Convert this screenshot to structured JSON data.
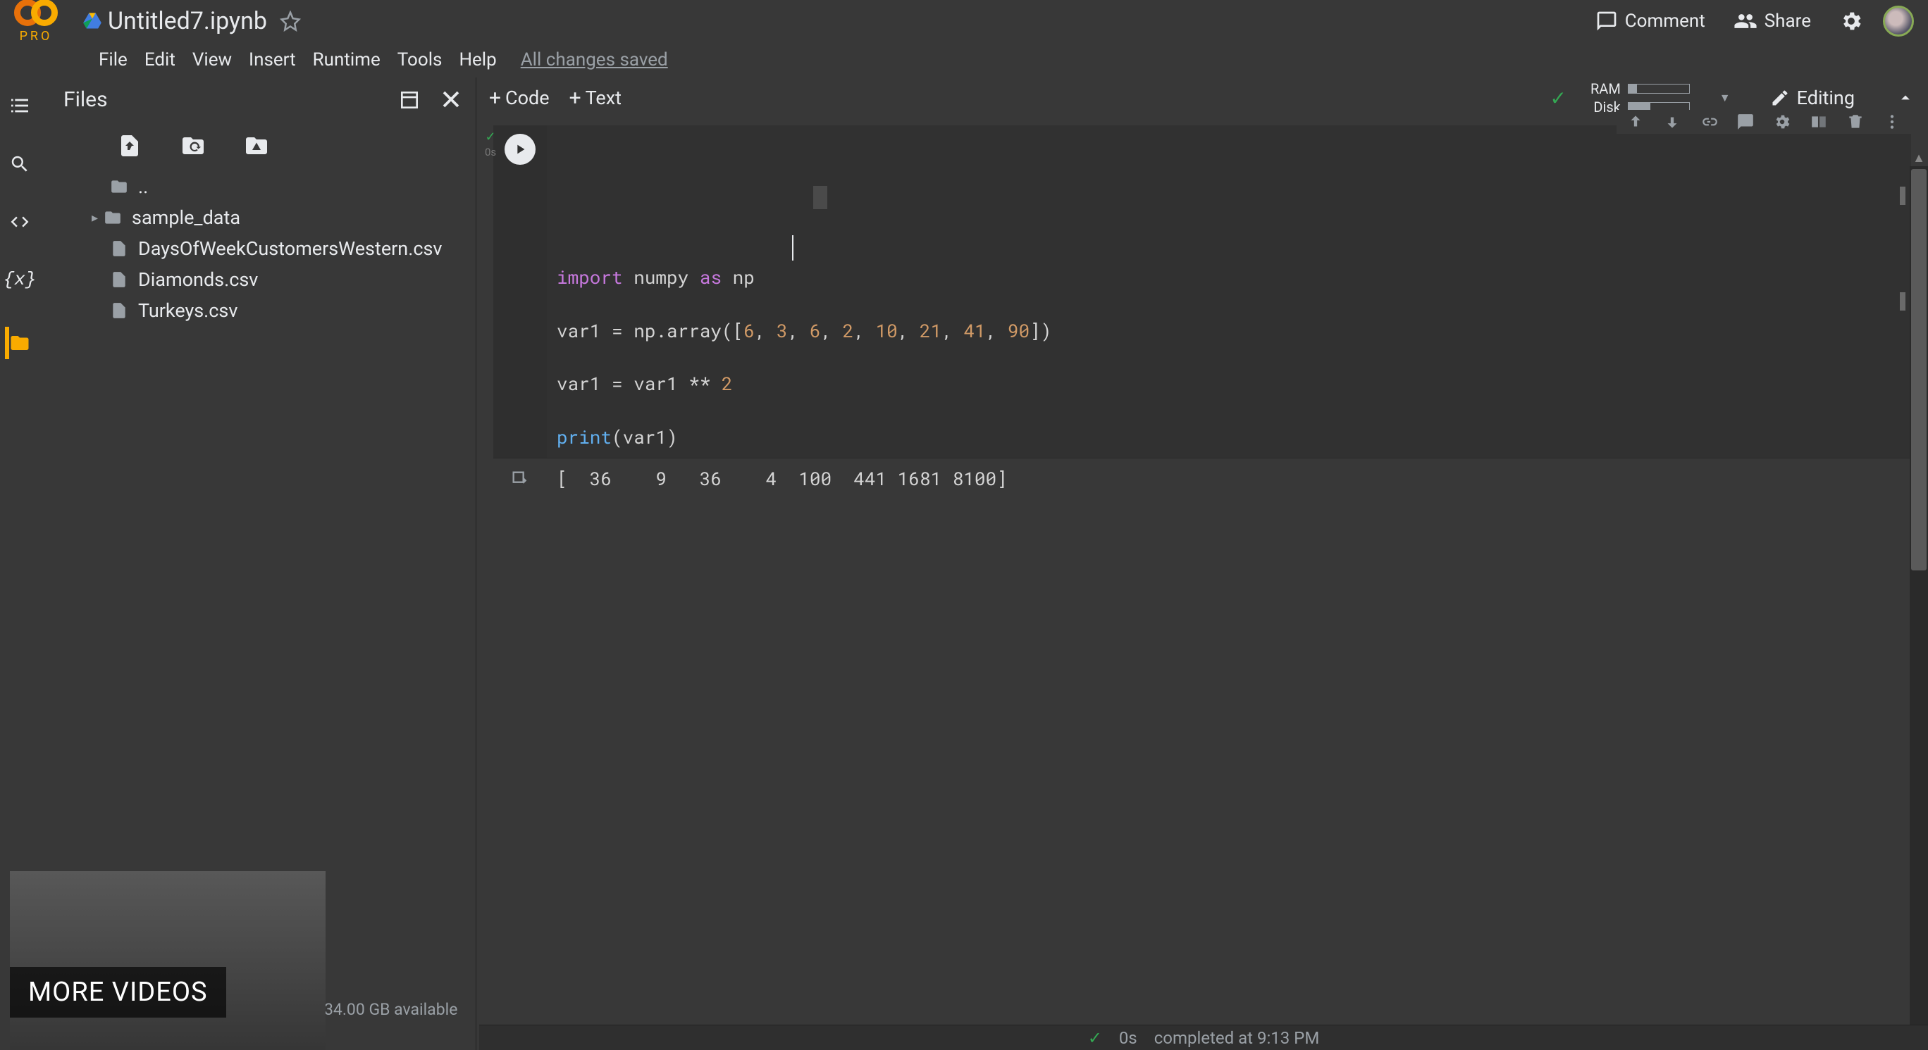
{
  "header": {
    "pro_label": "PRO",
    "notebook_title": "Untitled7.ipynb",
    "comment_label": "Comment",
    "share_label": "Share"
  },
  "menu": {
    "items": [
      "File",
      "Edit",
      "View",
      "Insert",
      "Runtime",
      "Tools",
      "Help"
    ],
    "save_status": "All changes saved"
  },
  "sidebar": {
    "title": "Files",
    "tree": {
      "parent": "..",
      "folder": "sample_data",
      "files": [
        "DaysOfWeekCustomersWestern.csv",
        "Diamonds.csv",
        "Turkeys.csv"
      ]
    },
    "disk_available": "34.00 GB available"
  },
  "toolbar": {
    "add_code": "Code",
    "add_text": "Text",
    "ram_label": "RAM",
    "disk_label": "Disk",
    "ram_fill_pct": 14,
    "disk_fill_pct": 36,
    "editing_label": "Editing"
  },
  "cell": {
    "exec_time": "0s",
    "code_lines": [
      {
        "tokens": [
          [
            "import",
            "keyword"
          ],
          [
            " numpy ",
            "default"
          ],
          [
            "as",
            "keyword"
          ],
          [
            " np",
            "default"
          ]
        ]
      },
      {
        "tokens": [
          [
            "",
            "default"
          ]
        ]
      },
      {
        "tokens": [
          [
            "var1 = np.array([",
            "default"
          ],
          [
            "6",
            "num"
          ],
          [
            ", ",
            "default"
          ],
          [
            "3",
            "num"
          ],
          [
            ", ",
            "default"
          ],
          [
            "6",
            "num"
          ],
          [
            ", ",
            "default"
          ],
          [
            "2",
            "num"
          ],
          [
            ", ",
            "default"
          ],
          [
            "10",
            "num"
          ],
          [
            ", ",
            "default"
          ],
          [
            "21",
            "num"
          ],
          [
            ", ",
            "default"
          ],
          [
            "41",
            "num"
          ],
          [
            ", ",
            "default"
          ],
          [
            "90",
            "num"
          ],
          [
            "])",
            "default"
          ]
        ]
      },
      {
        "tokens": [
          [
            "",
            "default"
          ]
        ]
      },
      {
        "tokens": [
          [
            "var1 = var1 ** ",
            "default"
          ],
          [
            "2",
            "num"
          ]
        ]
      },
      {
        "tokens": [
          [
            "",
            "default"
          ]
        ]
      },
      {
        "tokens": [
          [
            "print",
            "func"
          ],
          [
            "(var1)",
            "default"
          ]
        ]
      }
    ],
    "output": "[  36    9   36    4  100  441 1681 8100]"
  },
  "status_bar": {
    "exec_time": "0s",
    "completed": "completed at 9:13 PM"
  },
  "overlay": {
    "more_videos": "MORE VIDEOS"
  }
}
